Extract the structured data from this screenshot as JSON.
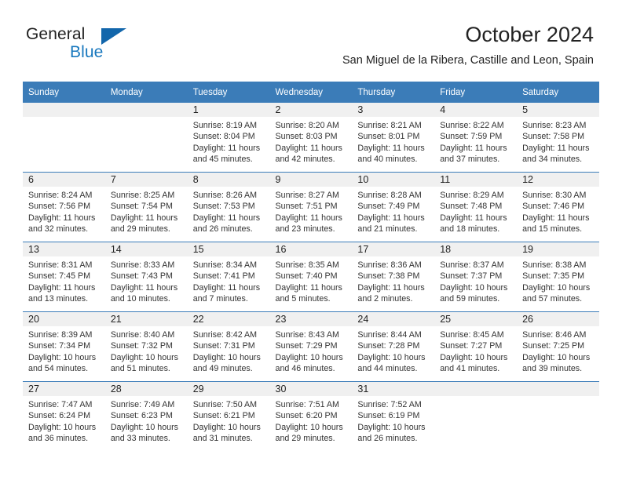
{
  "brand": {
    "line1": "General",
    "line2": "Blue",
    "triangle_color": "#1266ab",
    "blue_text_color": "#1878be"
  },
  "header": {
    "title": "October 2024",
    "subtitle": "San Miguel de la Ribera, Castille and Leon, Spain",
    "accent_color": "#3b7cb8",
    "band_color": "#f0f0f0"
  },
  "weekdays": [
    "Sunday",
    "Monday",
    "Tuesday",
    "Wednesday",
    "Thursday",
    "Friday",
    "Saturday"
  ],
  "weeks": [
    [
      {
        "day": ""
      },
      {
        "day": ""
      },
      {
        "day": "1",
        "sunrise": "Sunrise: 8:19 AM",
        "sunset": "Sunset: 8:04 PM",
        "daylight1": "Daylight: 11 hours",
        "daylight2": "and 45 minutes."
      },
      {
        "day": "2",
        "sunrise": "Sunrise: 8:20 AM",
        "sunset": "Sunset: 8:03 PM",
        "daylight1": "Daylight: 11 hours",
        "daylight2": "and 42 minutes."
      },
      {
        "day": "3",
        "sunrise": "Sunrise: 8:21 AM",
        "sunset": "Sunset: 8:01 PM",
        "daylight1": "Daylight: 11 hours",
        "daylight2": "and 40 minutes."
      },
      {
        "day": "4",
        "sunrise": "Sunrise: 8:22 AM",
        "sunset": "Sunset: 7:59 PM",
        "daylight1": "Daylight: 11 hours",
        "daylight2": "and 37 minutes."
      },
      {
        "day": "5",
        "sunrise": "Sunrise: 8:23 AM",
        "sunset": "Sunset: 7:58 PM",
        "daylight1": "Daylight: 11 hours",
        "daylight2": "and 34 minutes."
      }
    ],
    [
      {
        "day": "6",
        "sunrise": "Sunrise: 8:24 AM",
        "sunset": "Sunset: 7:56 PM",
        "daylight1": "Daylight: 11 hours",
        "daylight2": "and 32 minutes."
      },
      {
        "day": "7",
        "sunrise": "Sunrise: 8:25 AM",
        "sunset": "Sunset: 7:54 PM",
        "daylight1": "Daylight: 11 hours",
        "daylight2": "and 29 minutes."
      },
      {
        "day": "8",
        "sunrise": "Sunrise: 8:26 AM",
        "sunset": "Sunset: 7:53 PM",
        "daylight1": "Daylight: 11 hours",
        "daylight2": "and 26 minutes."
      },
      {
        "day": "9",
        "sunrise": "Sunrise: 8:27 AM",
        "sunset": "Sunset: 7:51 PM",
        "daylight1": "Daylight: 11 hours",
        "daylight2": "and 23 minutes."
      },
      {
        "day": "10",
        "sunrise": "Sunrise: 8:28 AM",
        "sunset": "Sunset: 7:49 PM",
        "daylight1": "Daylight: 11 hours",
        "daylight2": "and 21 minutes."
      },
      {
        "day": "11",
        "sunrise": "Sunrise: 8:29 AM",
        "sunset": "Sunset: 7:48 PM",
        "daylight1": "Daylight: 11 hours",
        "daylight2": "and 18 minutes."
      },
      {
        "day": "12",
        "sunrise": "Sunrise: 8:30 AM",
        "sunset": "Sunset: 7:46 PM",
        "daylight1": "Daylight: 11 hours",
        "daylight2": "and 15 minutes."
      }
    ],
    [
      {
        "day": "13",
        "sunrise": "Sunrise: 8:31 AM",
        "sunset": "Sunset: 7:45 PM",
        "daylight1": "Daylight: 11 hours",
        "daylight2": "and 13 minutes."
      },
      {
        "day": "14",
        "sunrise": "Sunrise: 8:33 AM",
        "sunset": "Sunset: 7:43 PM",
        "daylight1": "Daylight: 11 hours",
        "daylight2": "and 10 minutes."
      },
      {
        "day": "15",
        "sunrise": "Sunrise: 8:34 AM",
        "sunset": "Sunset: 7:41 PM",
        "daylight1": "Daylight: 11 hours",
        "daylight2": "and 7 minutes."
      },
      {
        "day": "16",
        "sunrise": "Sunrise: 8:35 AM",
        "sunset": "Sunset: 7:40 PM",
        "daylight1": "Daylight: 11 hours",
        "daylight2": "and 5 minutes."
      },
      {
        "day": "17",
        "sunrise": "Sunrise: 8:36 AM",
        "sunset": "Sunset: 7:38 PM",
        "daylight1": "Daylight: 11 hours",
        "daylight2": "and 2 minutes."
      },
      {
        "day": "18",
        "sunrise": "Sunrise: 8:37 AM",
        "sunset": "Sunset: 7:37 PM",
        "daylight1": "Daylight: 10 hours",
        "daylight2": "and 59 minutes."
      },
      {
        "day": "19",
        "sunrise": "Sunrise: 8:38 AM",
        "sunset": "Sunset: 7:35 PM",
        "daylight1": "Daylight: 10 hours",
        "daylight2": "and 57 minutes."
      }
    ],
    [
      {
        "day": "20",
        "sunrise": "Sunrise: 8:39 AM",
        "sunset": "Sunset: 7:34 PM",
        "daylight1": "Daylight: 10 hours",
        "daylight2": "and 54 minutes."
      },
      {
        "day": "21",
        "sunrise": "Sunrise: 8:40 AM",
        "sunset": "Sunset: 7:32 PM",
        "daylight1": "Daylight: 10 hours",
        "daylight2": "and 51 minutes."
      },
      {
        "day": "22",
        "sunrise": "Sunrise: 8:42 AM",
        "sunset": "Sunset: 7:31 PM",
        "daylight1": "Daylight: 10 hours",
        "daylight2": "and 49 minutes."
      },
      {
        "day": "23",
        "sunrise": "Sunrise: 8:43 AM",
        "sunset": "Sunset: 7:29 PM",
        "daylight1": "Daylight: 10 hours",
        "daylight2": "and 46 minutes."
      },
      {
        "day": "24",
        "sunrise": "Sunrise: 8:44 AM",
        "sunset": "Sunset: 7:28 PM",
        "daylight1": "Daylight: 10 hours",
        "daylight2": "and 44 minutes."
      },
      {
        "day": "25",
        "sunrise": "Sunrise: 8:45 AM",
        "sunset": "Sunset: 7:27 PM",
        "daylight1": "Daylight: 10 hours",
        "daylight2": "and 41 minutes."
      },
      {
        "day": "26",
        "sunrise": "Sunrise: 8:46 AM",
        "sunset": "Sunset: 7:25 PM",
        "daylight1": "Daylight: 10 hours",
        "daylight2": "and 39 minutes."
      }
    ],
    [
      {
        "day": "27",
        "sunrise": "Sunrise: 7:47 AM",
        "sunset": "Sunset: 6:24 PM",
        "daylight1": "Daylight: 10 hours",
        "daylight2": "and 36 minutes."
      },
      {
        "day": "28",
        "sunrise": "Sunrise: 7:49 AM",
        "sunset": "Sunset: 6:23 PM",
        "daylight1": "Daylight: 10 hours",
        "daylight2": "and 33 minutes."
      },
      {
        "day": "29",
        "sunrise": "Sunrise: 7:50 AM",
        "sunset": "Sunset: 6:21 PM",
        "daylight1": "Daylight: 10 hours",
        "daylight2": "and 31 minutes."
      },
      {
        "day": "30",
        "sunrise": "Sunrise: 7:51 AM",
        "sunset": "Sunset: 6:20 PM",
        "daylight1": "Daylight: 10 hours",
        "daylight2": "and 29 minutes."
      },
      {
        "day": "31",
        "sunrise": "Sunrise: 7:52 AM",
        "sunset": "Sunset: 6:19 PM",
        "daylight1": "Daylight: 10 hours",
        "daylight2": "and 26 minutes."
      },
      {
        "day": ""
      },
      {
        "day": ""
      }
    ]
  ]
}
